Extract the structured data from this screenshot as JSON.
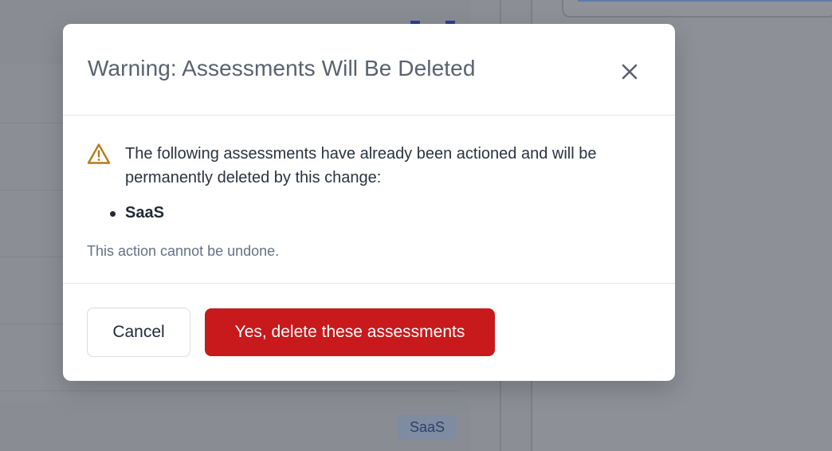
{
  "background": {
    "tag_label": "SaaS"
  },
  "modal": {
    "title": "Warning: Assessments Will Be Deleted",
    "close_icon": "close-icon",
    "warning_icon": "warning-triangle-icon",
    "message": "The following assessments have already been actioned and will be permanently deleted by this change:",
    "assessments": [
      "SaaS"
    ],
    "note": "This action cannot be undone.",
    "cancel_label": "Cancel",
    "confirm_label": "Yes, delete these assessments"
  },
  "colors": {
    "danger": "#c8191c",
    "warning": "#b7791f",
    "overlay": "#8b8f95"
  }
}
